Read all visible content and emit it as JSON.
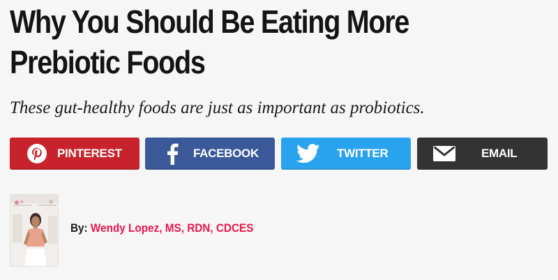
{
  "article": {
    "title_line1": "Why You Should Be Eating More",
    "title_line2": "Prebiotic Foods",
    "subtitle": "These gut-healthy foods are just as important as probiotics."
  },
  "share": {
    "buttons": [
      {
        "label": "PINTEREST",
        "icon": "pinterest-icon",
        "color": "#c8232c"
      },
      {
        "label": "FACEBOOK",
        "icon": "facebook-icon",
        "color": "#3b5998"
      },
      {
        "label": "TWITTER",
        "icon": "twitter-icon",
        "color": "#2aa3ef"
      },
      {
        "label": "EMAIL",
        "icon": "envelope-icon",
        "color": "#333333"
      }
    ]
  },
  "byline": {
    "prefix": "By:",
    "author": "Wendy Lopez, MS, RDN, CDCES",
    "author_color": "#e8174f"
  }
}
